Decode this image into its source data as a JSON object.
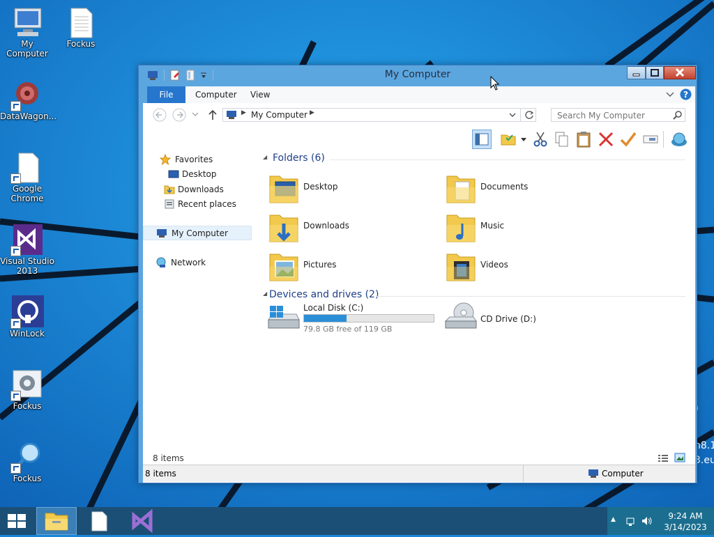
{
  "desktop": {
    "icons": [
      {
        "label": "My Computer"
      },
      {
        "label": "Fockus"
      },
      {
        "label": "DataWagon..."
      },
      {
        "label": "Google Chrome"
      },
      {
        "label": "Visual Studio 2013"
      },
      {
        "label": "WinLock"
      },
      {
        "label": "Fockus"
      },
      {
        "label": "Fockus"
      }
    ],
    "watermark_lines": [
      "n",
      "n8.1",
      "3.eu"
    ]
  },
  "window": {
    "title": "My Computer",
    "tabs": [
      "File",
      "Computer",
      "View"
    ],
    "address": {
      "location": "My Computer"
    },
    "search": {
      "placeholder": "Search My Computer"
    },
    "nav": {
      "favorites": "Favorites",
      "desktop": "Desktop",
      "downloads": "Downloads",
      "recent": "Recent places",
      "my_computer": "My Computer",
      "network": "Network"
    },
    "groups": {
      "folders_header": "Folders (6)",
      "devices_header": "Devices and drives (2)"
    },
    "folders": [
      {
        "name": "Desktop"
      },
      {
        "name": "Documents"
      },
      {
        "name": "Downloads"
      },
      {
        "name": "Music"
      },
      {
        "name": "Pictures"
      },
      {
        "name": "Videos"
      }
    ],
    "drives": [
      {
        "name": "Local Disk (C:)",
        "free_text": "79.8 GB free of 119 GB",
        "used_fraction": 0.33
      },
      {
        "name": "CD Drive (D:)"
      }
    ],
    "status": {
      "item_count_inner": "8 items",
      "item_count": "8 items",
      "location": "Computer"
    }
  },
  "taskbar": {
    "time": "9:24 AM",
    "date": "3/14/2023"
  },
  "colors": {
    "accent": "#2676cd",
    "drive_bar": "#2b8fd8"
  }
}
